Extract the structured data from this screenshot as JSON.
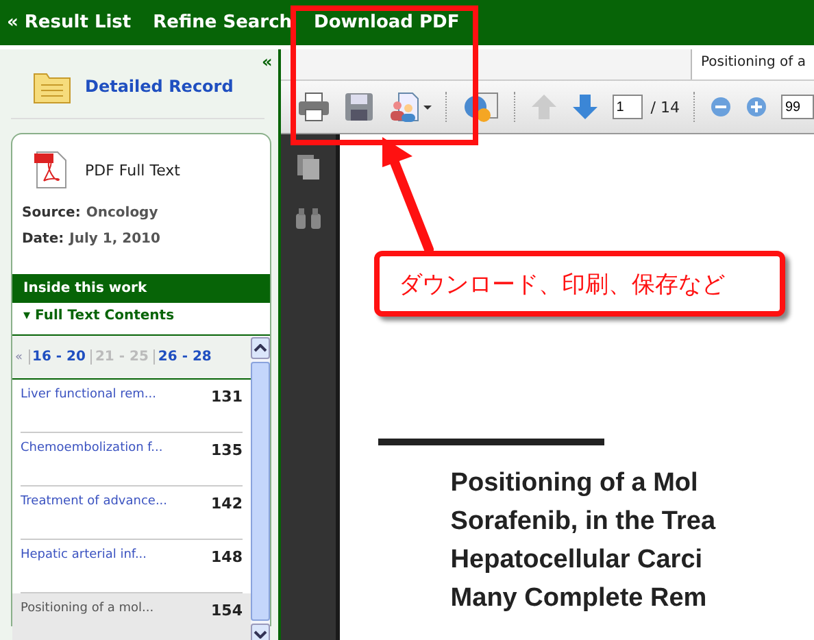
{
  "top_nav": [
    {
      "label": "« Result List"
    },
    {
      "label": "Refine Search"
    },
    {
      "label": "Download PDF"
    }
  ],
  "sidebar": {
    "collapse": "«",
    "detailed_record": "Detailed Record",
    "pdf_full_text": "PDF Full Text",
    "source_label": "Source:",
    "source_value": "Oncology",
    "date_label": "Date:",
    "date_value": "July 1,  2010",
    "section_title": "Inside this work",
    "contents_toggle": "▾ Full Text Contents",
    "pager": {
      "prev": "«",
      "pages": [
        {
          "label": "16 - 20",
          "selected": false
        },
        {
          "label": "21 - 25",
          "selected": true
        },
        {
          "label": "26 - 28",
          "selected": false
        }
      ]
    },
    "contents": [
      {
        "title": "Liver functional rem...",
        "page": "131",
        "selected": false
      },
      {
        "title": "Chemoembolization f...",
        "page": "135",
        "selected": false
      },
      {
        "title": "Treatment of advance...",
        "page": "142",
        "selected": false
      },
      {
        "title": "Hepatic arterial inf...",
        "page": "148",
        "selected": false
      },
      {
        "title": "Positioning of a mol...",
        "page": "154",
        "selected": true
      }
    ]
  },
  "viewer": {
    "tab_title": "Positioning of a",
    "page_number": "1",
    "page_total": "/ 14",
    "zoom": "99",
    "document_title_lines": [
      "Positioning of a Mol",
      "Sorafenib, in the Trea",
      "Hepatocellular Carci",
      "Many Complete Rem"
    ]
  },
  "annotation": {
    "callout": "ダウンロード、印刷、保存など"
  }
}
